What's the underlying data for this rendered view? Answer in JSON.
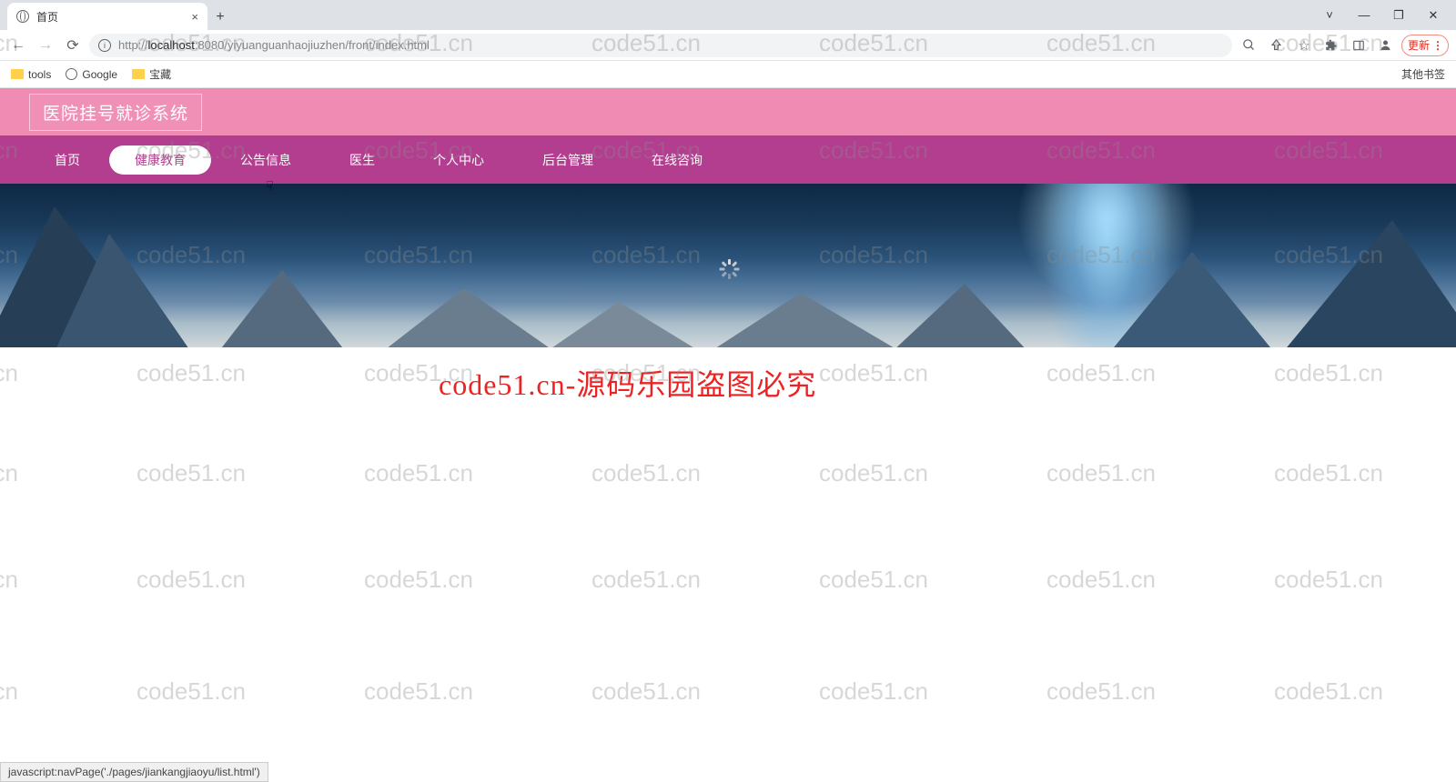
{
  "browser": {
    "tab_title": "首页",
    "url_prefix": "http://",
    "url_host": "localhost",
    "url_port": ":8080",
    "url_path": "/yiyuanguanhaojiuzhen/front/index.html",
    "update_label": "更新",
    "other_bookmarks": "其他书签",
    "bookmarks": [
      {
        "label": "tools",
        "type": "folder"
      },
      {
        "label": "Google",
        "type": "globe"
      },
      {
        "label": "宝藏",
        "type": "folder"
      }
    ]
  },
  "site": {
    "title": "医院挂号就诊系统",
    "nav": [
      "首页",
      "健康教育",
      "公告信息",
      "医生",
      "个人中心",
      "后台管理",
      "在线咨询"
    ],
    "active_nav_index": 1
  },
  "watermark_main": "code51.cn-源码乐园盗图必究",
  "watermark_repeat": "code51.cn",
  "status_text": "javascript:navPage('./pages/jiankangjiaoyu/list.html')"
}
